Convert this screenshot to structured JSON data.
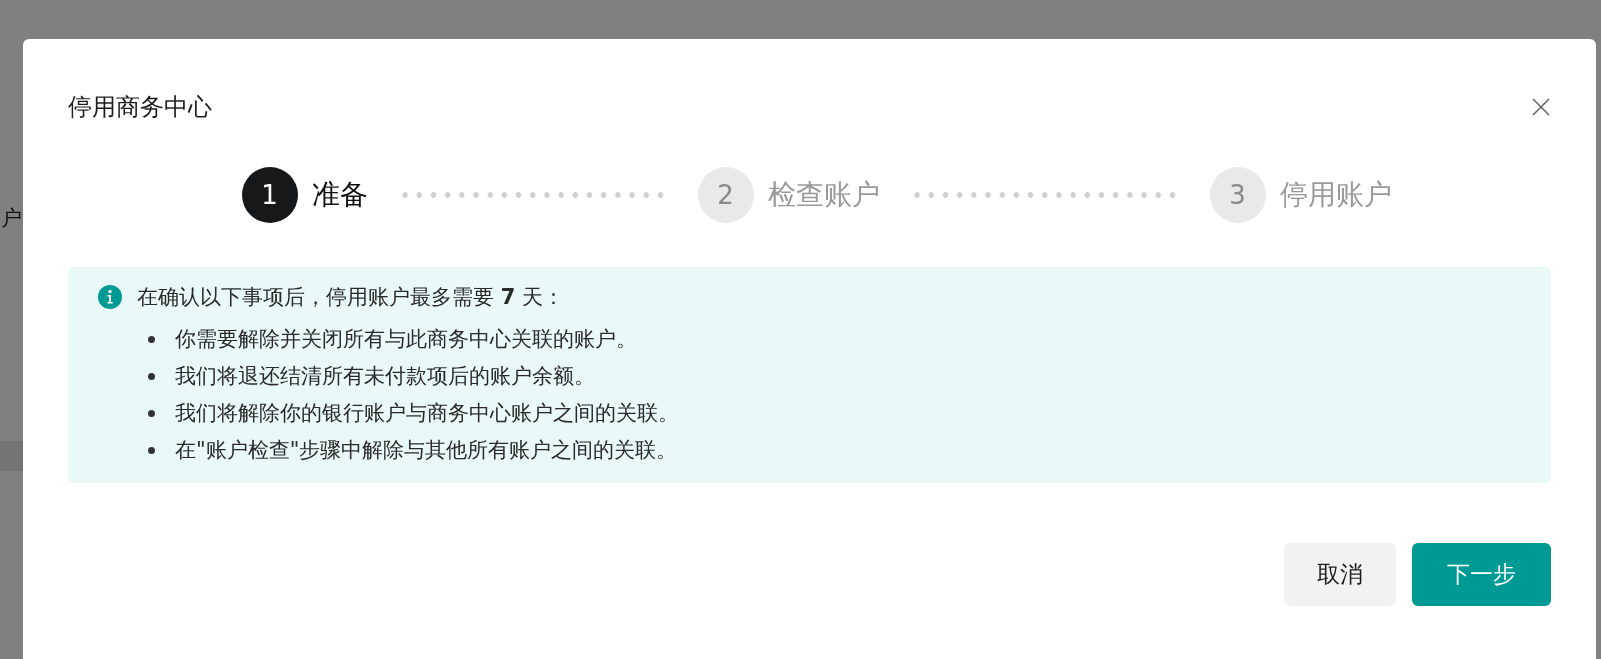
{
  "background": {
    "partial_text": "户"
  },
  "dialog": {
    "title": "停用商务中心",
    "steps": [
      {
        "number": "1",
        "label": "准备",
        "selected": true
      },
      {
        "number": "2",
        "label": "检查账户",
        "selected": false
      },
      {
        "number": "3",
        "label": "停用账户",
        "selected": false
      }
    ],
    "notice": {
      "heading": "在确认以下事项后，停用账户最多需要 **7** 天：",
      "items": [
        "你需要解除并关闭所有与此商务中心关联的账户。",
        "我们将退还结清所有未付款项后的账户余额。",
        "我们将解除你的银行账户与商务中心账户之间的关联。",
        "在\"账户检查\"步骤中解除与其他所有账户之间的关联。"
      ]
    },
    "buttons": [
      {
        "label": "取消",
        "kind": "secondary"
      },
      {
        "label": "下一步",
        "kind": "primary"
      }
    ]
  }
}
